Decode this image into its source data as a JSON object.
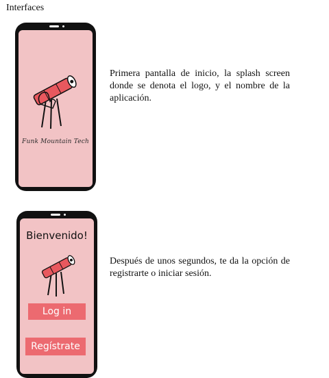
{
  "section": {
    "title": "Interfaces"
  },
  "screens": [
    {
      "brand_text": "Funk Mountain Tech",
      "description": "Primera pantalla de inicio, la splash screen donde se denota el logo, y el nombre de la aplicación."
    },
    {
      "welcome": "Bienvenido!",
      "login_label": "Log in",
      "register_label": "Regístrate",
      "description": "Después de unos segundos, te da la opción de registrarte o iniciar sesión."
    }
  ],
  "colors": {
    "screen_bg": "#f2c3c5",
    "button_bg": "#ec6a70",
    "logo_red": "#e8585e",
    "phone_frame": "#111111"
  }
}
